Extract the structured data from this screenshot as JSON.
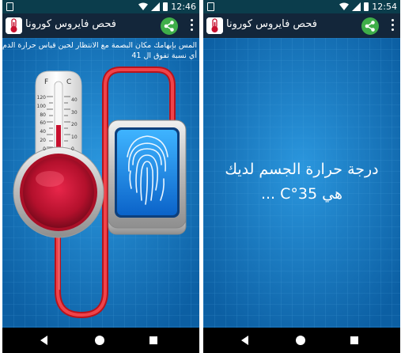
{
  "colors": {
    "status_bar": "#0b3d4c",
    "app_bar": "#13263a",
    "content_bg": "#1379c2",
    "share_green": "#3fae49",
    "thermo_red": "#c8102e",
    "tube_red": "#e0262c",
    "scanner_blue": "#1b8fe6"
  },
  "left_screen": {
    "status": {
      "time": "12:46"
    },
    "app_bar": {
      "title": "فحص فايروس كورونا"
    },
    "instruction": {
      "line1": "المس بإبهامك مكان البصمة مع الانتظار لحين قياس حرارة الدم , يرجى الإبلاغ عن",
      "line2": "أي نسبة تفوق ال 41"
    },
    "thermometer": {
      "unit_f": "F",
      "unit_c": "C",
      "f_ticks": [
        "120",
        "100",
        "80",
        "60",
        "40",
        "20",
        "0"
      ],
      "c_ticks": [
        "40",
        "30",
        "20",
        "10",
        "0"
      ]
    }
  },
  "right_screen": {
    "status": {
      "time": "12:54"
    },
    "app_bar": {
      "title": "فحص فايروس كورونا"
    },
    "result": {
      "line1": "درجة حرارة الجسم لديك",
      "line2": "هي 35°C ..."
    }
  },
  "icons": [
    "app-logo-icon",
    "share-icon",
    "more-vert-icon",
    "wifi-icon",
    "signal-icon",
    "battery-icon",
    "back-icon",
    "home-icon",
    "recents-icon",
    "fingerprint-icon",
    "thermometer-icon"
  ]
}
